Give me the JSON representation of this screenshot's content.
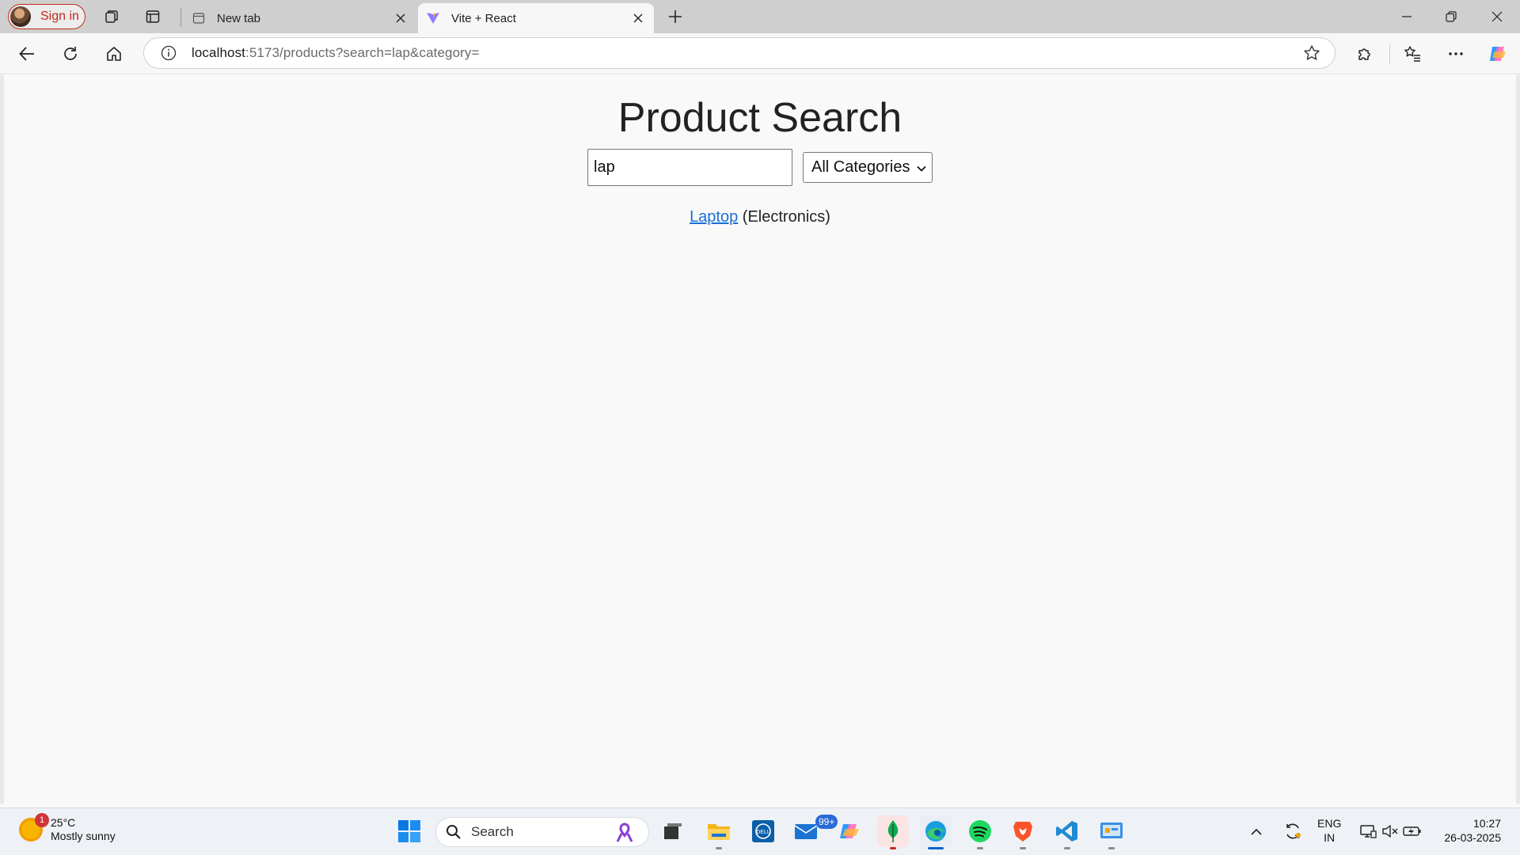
{
  "browser": {
    "profile_label": "Sign in",
    "tabs": [
      {
        "title": "New tab",
        "icon": "new-tab-page-icon",
        "active": false
      },
      {
        "title": "Vite + React",
        "icon": "vite-logo-icon",
        "active": true
      }
    ],
    "address": {
      "host": "localhost",
      "rest": ":5173/products?search=lap&category="
    }
  },
  "page": {
    "title": "Product Search",
    "search_value": "lap",
    "category_selected": "All Categories",
    "results": [
      {
        "name": "Laptop",
        "category": "(Electronics)"
      }
    ]
  },
  "taskbar": {
    "weather": {
      "temp": "25°C",
      "condition": "Mostly sunny",
      "badge": "1"
    },
    "search_placeholder": "Search",
    "mail_badge": "99+",
    "lang_top": "ENG",
    "lang_bottom": "IN",
    "time": "10:27",
    "date": "26-03-2025"
  },
  "colors": {
    "accent_link": "#1a6ed8",
    "signin_red": "#c42b1c",
    "page_bg": "#f9f9f9"
  }
}
